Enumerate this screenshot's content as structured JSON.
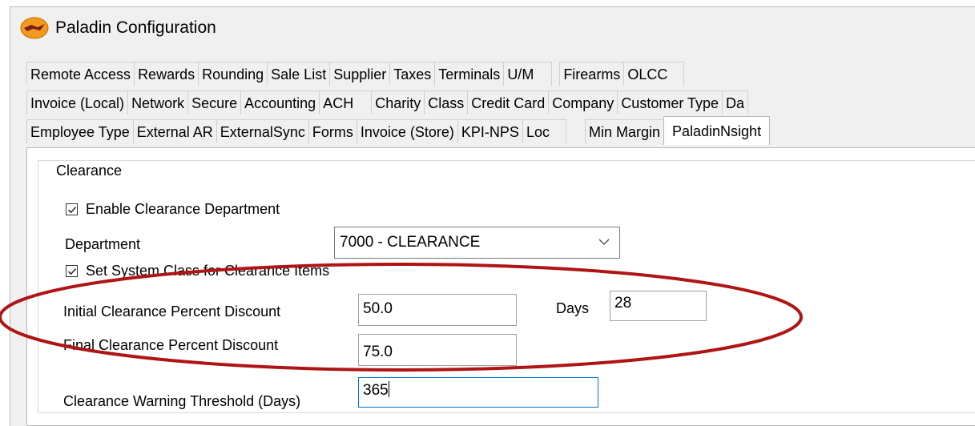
{
  "window": {
    "title": "Paladin Configuration",
    "icon": "paladin-app-icon"
  },
  "tabs": {
    "row1": [
      "Remote Access",
      "Rewards",
      "Rounding",
      "Sale List",
      "Supplier",
      "Taxes",
      "Terminals",
      "U/M",
      "Firearms",
      "OLCC"
    ],
    "row2": [
      "Invoice (Local)",
      "Network",
      "Secure",
      "Accounting",
      "ACH",
      "Charity",
      "Class",
      "Credit Card",
      "Company",
      "Customer Type",
      "Da"
    ],
    "row3": [
      "Employee Type",
      "External AR",
      "ExternalSync",
      "Forms",
      "Invoice (Store)",
      "KPI-NPS",
      "Loc",
      "Min Margin",
      "PaladinNsight"
    ],
    "active": "PaladinNsight"
  },
  "clearance": {
    "group_title": "Clearance",
    "enable_label": "Enable Clearance Department",
    "enable_checked": true,
    "department_label": "Department",
    "department_value": "7000 - CLEARANCE",
    "set_class_label": "Set System Class for Clearance Items",
    "set_class_checked": true,
    "initial_label": "Initial Clearance Percent Discount",
    "initial_value": "50.0",
    "days_label": "Days",
    "days_value": "28",
    "final_label": "Final Clearance Percent Discount",
    "final_value": "75.0",
    "warning_label": "Clearance Warning Threshold (Days)",
    "warning_value": "365"
  },
  "colors": {
    "annotation_ellipse": "#b01515",
    "focus_border": "#0078d7",
    "window_bg": "#f0f0f0"
  }
}
